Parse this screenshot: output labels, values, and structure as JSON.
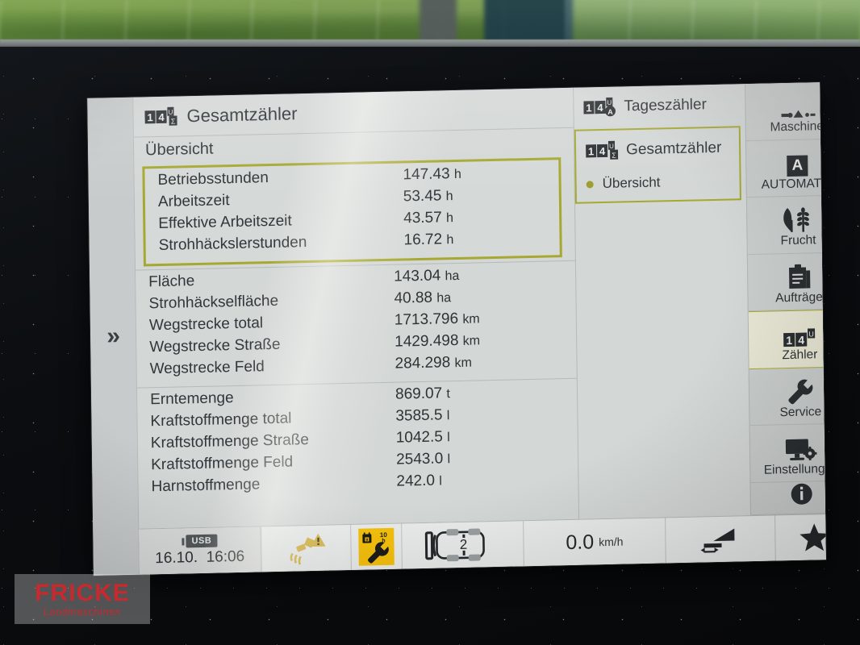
{
  "screen": {
    "expand_chevron": "»",
    "header": {
      "icon": "counter-total-icon",
      "title": "Gesamtzähler"
    },
    "subhead": "Übersicht",
    "groups": [
      {
        "highlighted": true,
        "rows": [
          {
            "label": "Betriebsstunden",
            "value": "147.43",
            "unit": "h"
          },
          {
            "label": "Arbeitszeit",
            "value": "53.45",
            "unit": "h"
          },
          {
            "label": "Effektive Arbeitszeit",
            "value": "43.57",
            "unit": "h"
          },
          {
            "label": "Strohhäckslerstunden",
            "value": "16.72",
            "unit": "h"
          }
        ]
      },
      {
        "highlighted": false,
        "rows": [
          {
            "label": "Fläche",
            "value": "143.04",
            "unit": "ha"
          },
          {
            "label": "Strohhäckselfläche",
            "value": "40.88",
            "unit": "ha"
          },
          {
            "label": "Wegstrecke total",
            "value": "1713.796",
            "unit": "km"
          },
          {
            "label": "Wegstrecke Straße",
            "value": "1429.498",
            "unit": "km"
          },
          {
            "label": "Wegstrecke Feld",
            "value": "284.298",
            "unit": "km"
          }
        ]
      },
      {
        "highlighted": false,
        "rows": [
          {
            "label": "Erntemenge",
            "value": "869.07",
            "unit": "t"
          },
          {
            "label": "Kraftstoffmenge total",
            "value": "3585.5",
            "unit": "l"
          },
          {
            "label": "Kraftstoffmenge Straße",
            "value": "1042.5",
            "unit": "l"
          },
          {
            "label": "Kraftstoffmenge Feld",
            "value": "2543.0",
            "unit": "l"
          },
          {
            "label": "Harnstoffmenge",
            "value": "242.0",
            "unit": "l"
          }
        ]
      }
    ],
    "counter_panel": {
      "day_counter": {
        "icon": "counter-day-icon",
        "label": "Tageszähler"
      },
      "total_counter": {
        "icon": "counter-total-icon",
        "label": "Gesamtzähler"
      },
      "selected_entry": "Übersicht"
    },
    "sidebar": [
      {
        "icon": "combine-harvester-icon",
        "label": "Maschine",
        "active": false
      },
      {
        "icon": "automatic-a-icon",
        "label": "AUTOMATIC",
        "active": false
      },
      {
        "icon": "grain-ears-icon",
        "label": "Frucht",
        "active": false
      },
      {
        "icon": "clipboard-icon",
        "label": "Aufträge",
        "active": false
      },
      {
        "icon": "counter-14-icon",
        "label": "Zähler",
        "active": true
      },
      {
        "icon": "wrench-icon",
        "label": "Service",
        "active": false
      },
      {
        "icon": "monitor-gear-icon",
        "label": "Einstellungen",
        "active": false
      },
      {
        "icon": "info-icon",
        "label": "",
        "active": false
      }
    ],
    "status_bar": {
      "usb_badge": "USB",
      "date": "16.10.",
      "time": "16:06",
      "gps_warning_icon": "gps-warning-icon",
      "service_due_icon": "service-wrench-icon",
      "service_due_value": "10",
      "service_due_unit": "h",
      "machine_icon": "machine-topview-icon",
      "machine_number": "2",
      "speed_value": "0.0",
      "speed_unit": "km/h",
      "adjust_icon": "header-adjust-icon",
      "favorite_icon": "star-icon"
    }
  },
  "watermark": {
    "line1": "FRICKE",
    "line2": "Landmaschinen"
  },
  "theme": {
    "accent_olive": "#a6a831",
    "lcd_bg": "#d3d7d6",
    "warning_yellow": "#f5c00c",
    "text_dark": "#2e3235",
    "brand_red": "#d0262b"
  }
}
